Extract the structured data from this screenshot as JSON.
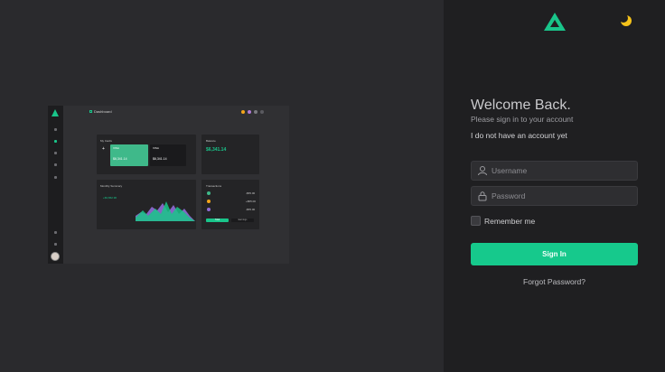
{
  "preview": {
    "title": "Dashboard",
    "my_cards": "My Cards",
    "card1_name": "VISA",
    "card1_balance": "$6,341.14",
    "card2_name": "VISA",
    "card2_balance": "$6,341.14",
    "balance_label": "Balance",
    "balance_value": "$6,341.14",
    "monthly_summary": "Monthly Summary",
    "income": "+$3,862.96",
    "transactions": "Transactions",
    "tx_amounts": [
      "-$55.00",
      "+$55.00",
      "-$55.00"
    ],
    "chart_values": [
      3,
      5,
      4,
      7,
      6,
      9,
      5,
      8,
      4,
      7,
      6,
      3
    ],
    "btn_left": "Total",
    "btn_right": "Earnings",
    "colors": {
      "accent": "#19c58a",
      "purple": "#8f6bd6"
    }
  },
  "auth": {
    "welcome": "Welcome Back.",
    "subtitle": "Please sign in to your account",
    "no_account": "I do not have an account yet",
    "username_placeholder": "Username",
    "password_placeholder": "Password",
    "remember_me": "Remember me",
    "sign_in": "Sign In",
    "forgot_password": "Forgot Password?"
  },
  "icons": {
    "logo": "triangle-logo-icon",
    "theme": "moon-icon",
    "user": "user-icon",
    "lock": "lock-icon"
  },
  "colors": {
    "accent": "#16c98c",
    "theme_icon": "#f4c21a",
    "background_left": "#2a2a2d",
    "background_right": "#1f1f21"
  }
}
